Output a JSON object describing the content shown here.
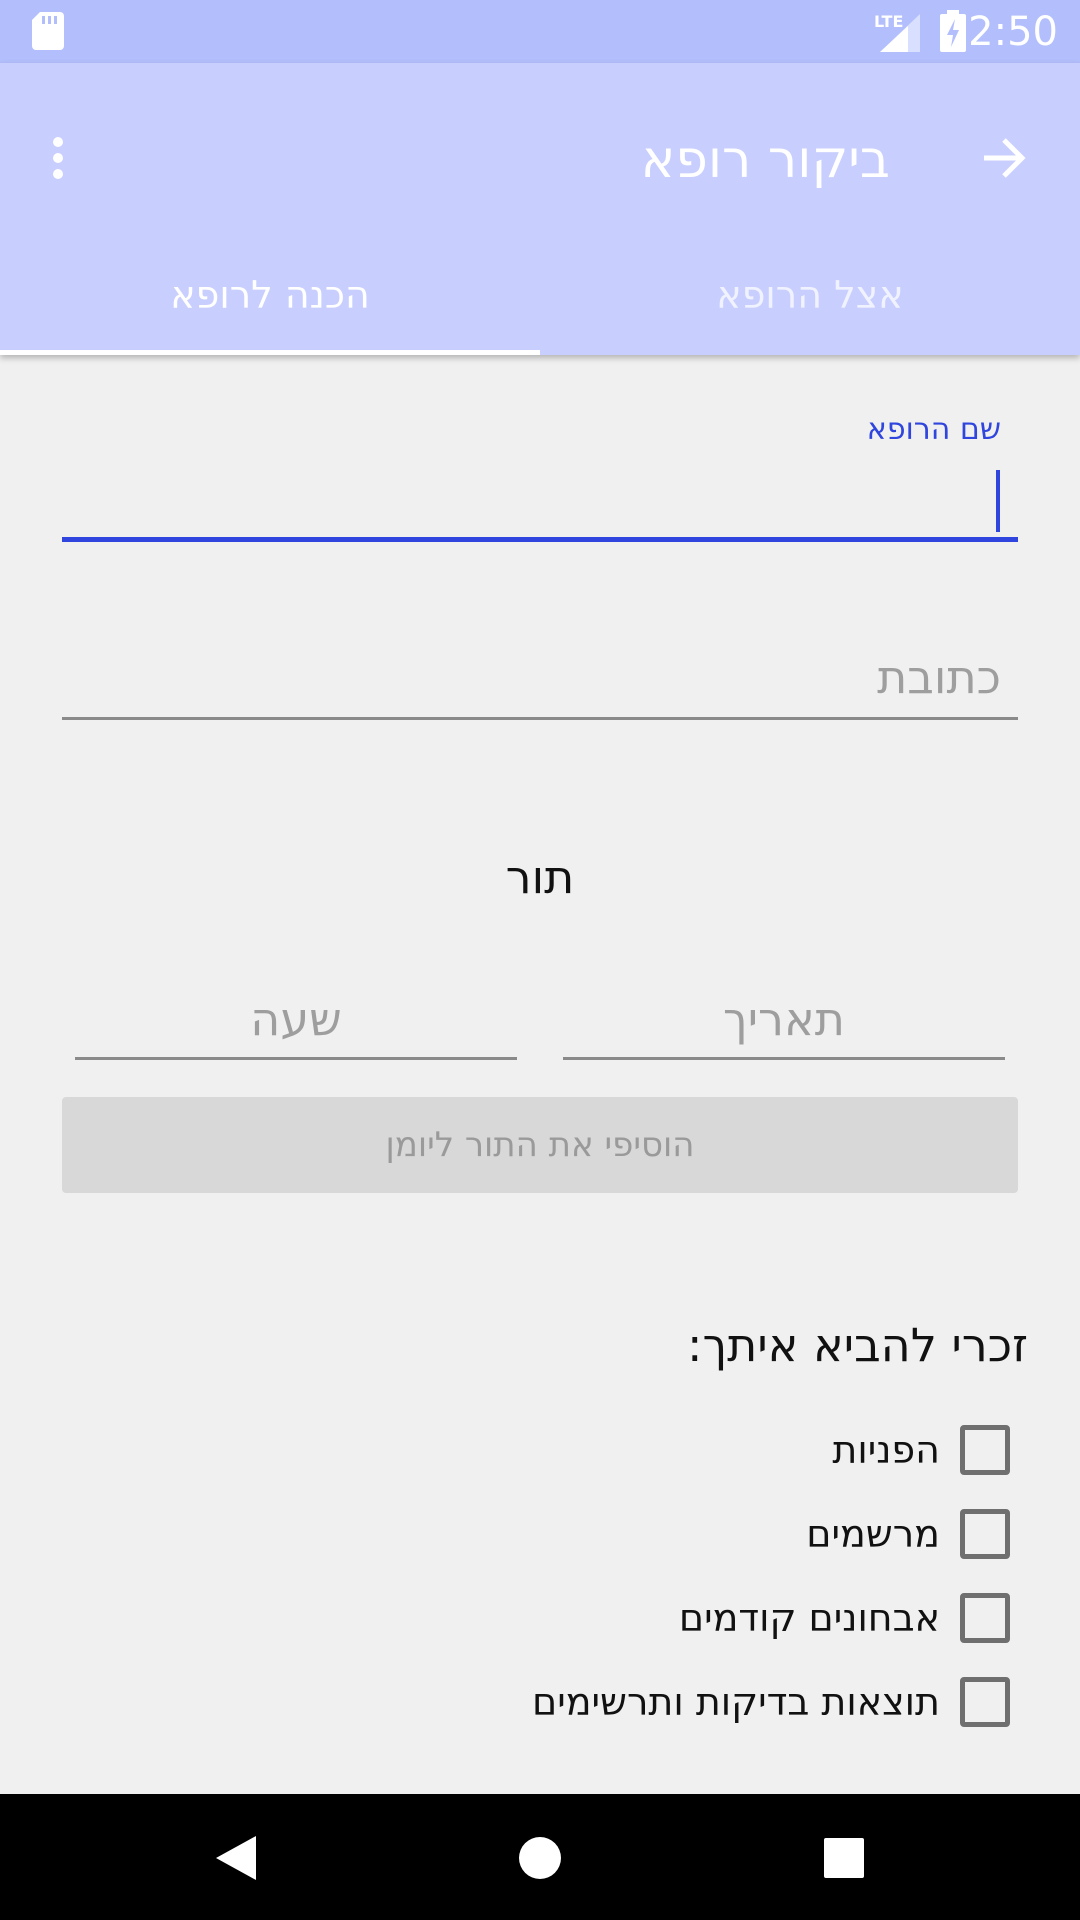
{
  "status_bar": {
    "time": "2:50",
    "network": "LTE",
    "icons": [
      "sd-card-icon",
      "signal-icon",
      "battery-charging-icon"
    ]
  },
  "app_bar": {
    "title": "ביקור רופא",
    "back_icon": "arrow-forward-icon",
    "menu_icon": "more-vert-icon"
  },
  "tabs": {
    "active": "הכנה לרופא",
    "inactive": "אצל הרופא"
  },
  "form": {
    "doctor_name_label": "שם הרופא",
    "doctor_name_value": "",
    "address_placeholder": "כתובת",
    "appointment_title": "תור",
    "date_placeholder": "תאריך",
    "time_placeholder": "שעה",
    "add_button_label": "הוסיפי את התור ליומן"
  },
  "checklist": {
    "title": "זכרי להביא איתך:",
    "items": [
      {
        "label": "הפניות",
        "checked": false
      },
      {
        "label": "מרשמים",
        "checked": false
      },
      {
        "label": "אבחונים קודמים",
        "checked": false
      },
      {
        "label": "תוצאות בדיקות ותרשימים",
        "checked": false
      }
    ]
  },
  "colors": {
    "status_bar": "#b3bffc",
    "app_bar": "#c8cffe",
    "accent": "#2f45dd",
    "background": "#f0f0f0"
  }
}
